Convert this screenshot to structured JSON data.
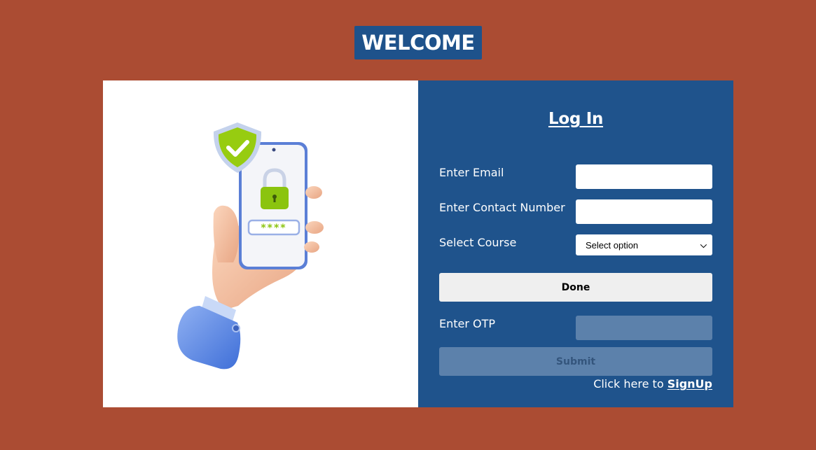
{
  "header": {
    "welcome": "WELCOME"
  },
  "illustration": {
    "password_mask": "****"
  },
  "form": {
    "title": "Log In",
    "email_label": "Enter Email",
    "email_value": "",
    "contact_label": "Enter Contact Number",
    "contact_value": "",
    "course_label": "Select Course",
    "course_selected": "Select option",
    "done_label": "Done",
    "otp_label": "Enter OTP",
    "submit_label": "Submit",
    "signup_prefix": "Click here to",
    "signup_link": "SignUp"
  },
  "colors": {
    "page_background": "#ab4c33",
    "panel_blue": "#1f538c",
    "disabled_field": "#5c81ab",
    "check_green": "#9ccc1c"
  }
}
